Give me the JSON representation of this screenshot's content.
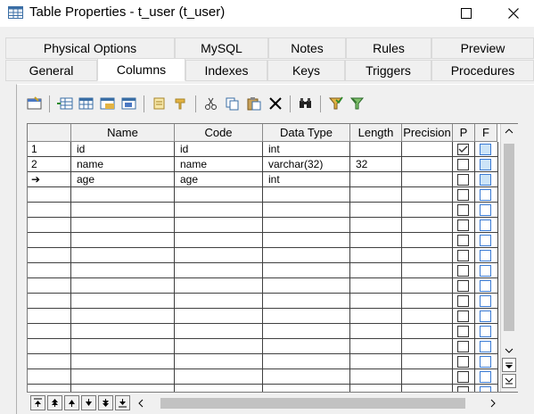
{
  "window": {
    "title": "Table Properties - t_user (t_user)",
    "icon": "table-icon"
  },
  "tabs": {
    "row1": [
      {
        "label": "Physical Options"
      },
      {
        "label": "MySQL"
      },
      {
        "label": "Notes"
      },
      {
        "label": "Rules"
      },
      {
        "label": "Preview"
      }
    ],
    "row2": [
      {
        "label": "General"
      },
      {
        "label": "Columns"
      },
      {
        "label": "Indexes"
      },
      {
        "label": "Keys"
      },
      {
        "label": "Triggers"
      },
      {
        "label": "Procedures"
      }
    ],
    "active": "Columns"
  },
  "toolbar": {
    "buttons": [
      "properties-icon",
      "insert-row-icon",
      "add-row-icon",
      "add-columns-icon",
      "replace-column-icon",
      "find-icon",
      "filter-icon",
      "cut-icon",
      "copy-icon",
      "paste-icon",
      "delete-icon",
      "find-binoculars-icon",
      "filter-funnel-icon",
      "clear-filter-icon"
    ]
  },
  "grid": {
    "headers": [
      "Name",
      "Code",
      "Data Type",
      "Length",
      "Precision",
      "P",
      "F"
    ],
    "rows": [
      {
        "num": "1",
        "name": "id",
        "code": "id",
        "data_type": "int",
        "length": "",
        "precision": "",
        "p_checked": true,
        "f_checked": false
      },
      {
        "num": "2",
        "name": "name",
        "code": "name",
        "data_type": "varchar(32)",
        "length": "32",
        "precision": "",
        "p_checked": false,
        "f_checked": false
      },
      {
        "num": "➔",
        "name": "age",
        "code": "age",
        "data_type": "int",
        "length": "",
        "precision": "",
        "p_checked": false,
        "f_checked": false
      }
    ],
    "empty_rows": 14
  },
  "colors": {
    "accent": "#3a7bd5",
    "window_bg": "#f0f0f0"
  }
}
